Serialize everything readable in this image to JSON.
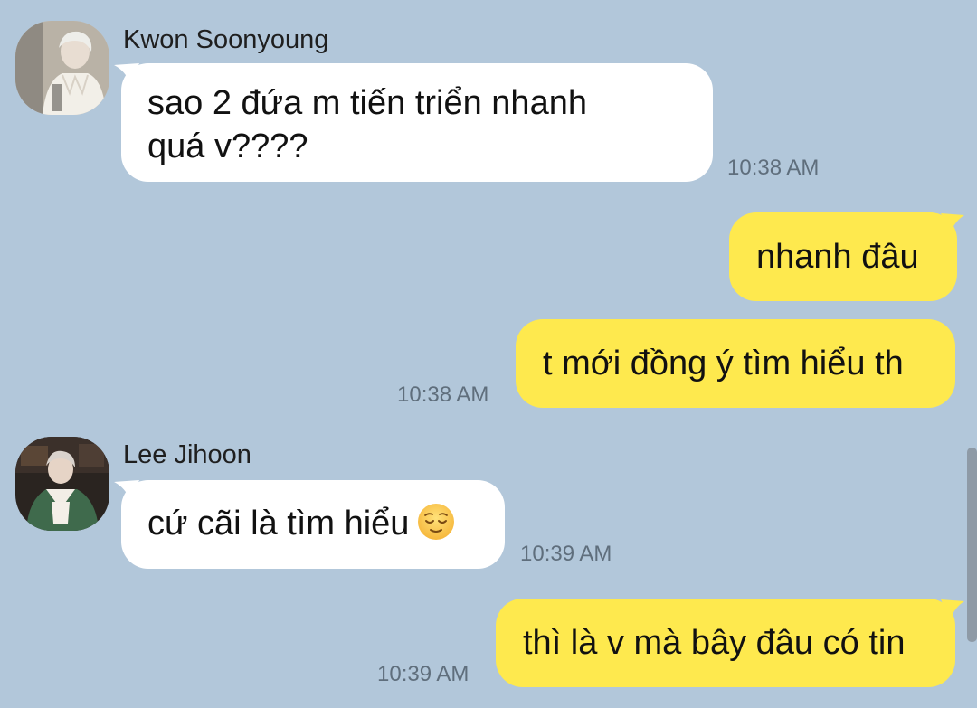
{
  "colors": {
    "background": "#b2c7da",
    "incoming_bubble": "#ffffff",
    "outgoing_bubble": "#fee94e",
    "timestamp": "#5f6e7c"
  },
  "messages": [
    {
      "sender": "Kwon Soonyoung",
      "direction": "incoming",
      "lines": [
        "sao 2 đứa m tiến triển nhanh",
        "quá v????"
      ],
      "time": "10:38 AM"
    },
    {
      "direction": "outgoing",
      "text": "nhanh đâu"
    },
    {
      "direction": "outgoing",
      "text": "t mới đồng ý tìm hiểu th",
      "time": "10:38 AM"
    },
    {
      "sender": "Lee Jihoon",
      "direction": "incoming",
      "text": "cứ cãi là tìm hiểu",
      "emoji": "relieved-face-icon",
      "time": "10:39 AM"
    },
    {
      "direction": "outgoing",
      "text": "thì là v mà bây đâu có tin",
      "time": "10:39 AM"
    }
  ]
}
